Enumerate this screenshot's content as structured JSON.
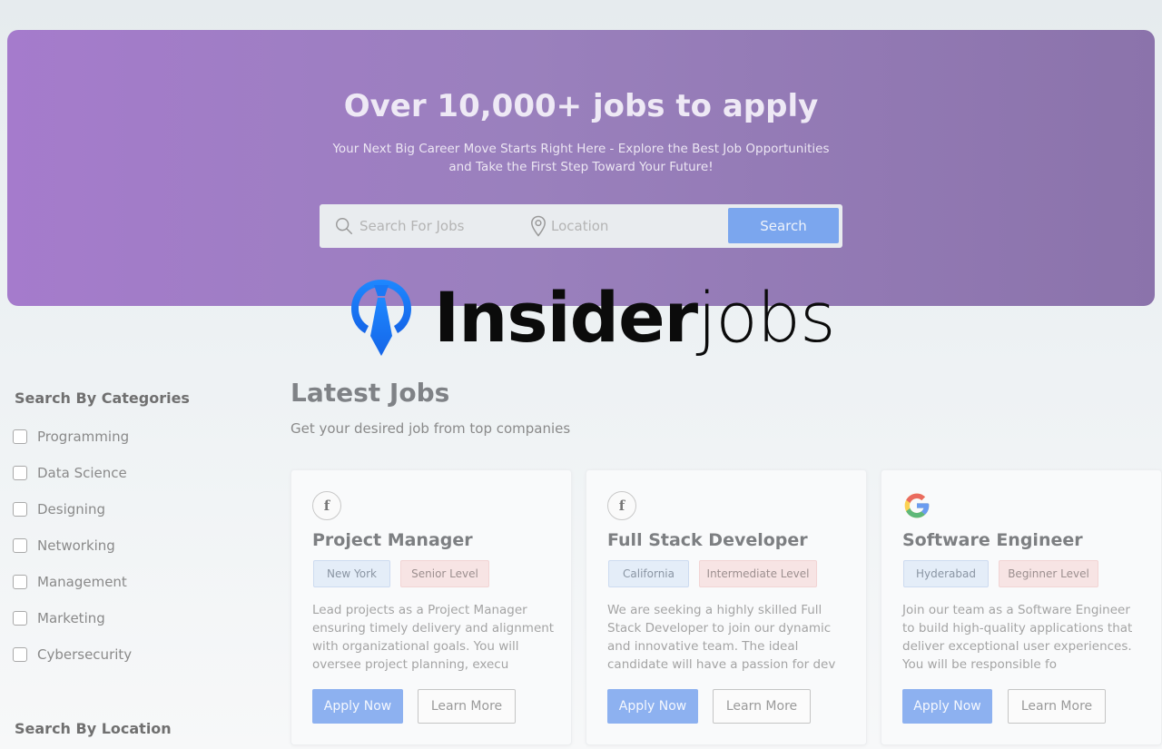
{
  "hero": {
    "title": "Over 10,000+ jobs to apply",
    "subtitle": "Your Next Big Career Move Starts Right Here - Explore the Best Job Opportunities and Take the First Step Toward Your Future!",
    "search_placeholder": "Search For Jobs",
    "location_placeholder": "Location",
    "search_button": "Search"
  },
  "logo": {
    "text_bold": "Insider",
    "text_light": "jobs",
    "brand_color": "#1877f2"
  },
  "sidebar": {
    "categories_heading": "Search By Categories",
    "categories": [
      "Programming",
      "Data Science",
      "Designing",
      "Networking",
      "Management",
      "Marketing",
      "Cybersecurity"
    ],
    "location_heading": "Search By Location"
  },
  "main": {
    "title": "Latest Jobs",
    "subtitle": "Get your desired job from top companies"
  },
  "jobs": [
    {
      "company_icon": "facebook-icon",
      "title": "Project Manager",
      "location": "New York",
      "level": "Senior Level",
      "description": "Lead projects as a Project Manager ensuring timely delivery and alignment with organizational goals. You will oversee project planning, execu",
      "apply_label": "Apply Now",
      "learn_label": "Learn More"
    },
    {
      "company_icon": "facebook-icon",
      "title": "Full Stack Developer",
      "location": "California",
      "level": "Intermediate Level",
      "description": "We are seeking a highly skilled Full Stack Developer to join our dynamic and innovative team. The ideal candidate will have a passion for dev",
      "apply_label": "Apply Now",
      "learn_label": "Learn More"
    },
    {
      "company_icon": "google-icon",
      "title": "Software Engineer",
      "location": "Hyderabad",
      "level": "Beginner Level",
      "description": "Join our team as a Software Engineer to build high-quality applications that deliver exceptional user experiences. You will be responsible fo",
      "apply_label": "Apply Now",
      "learn_label": "Learn More"
    }
  ],
  "colors": {
    "hero_start": "#a57bcc",
    "hero_end": "#8b73ab",
    "primary_button": "#7ba6ee",
    "tag_location": "#e4edf8",
    "tag_level": "#f7e4e4"
  }
}
